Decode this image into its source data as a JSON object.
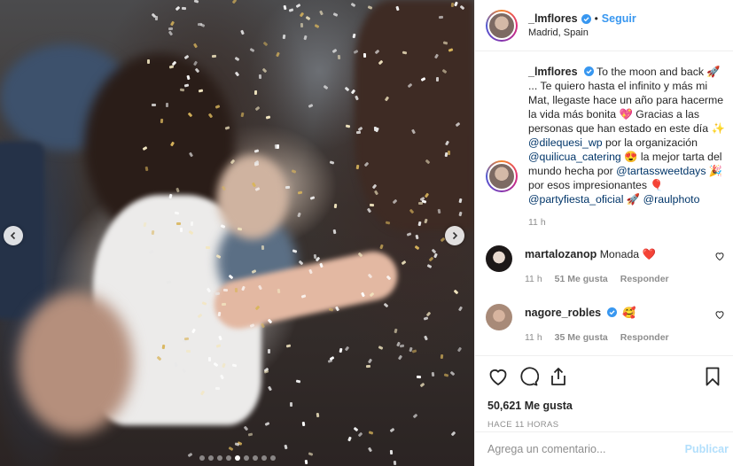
{
  "post": {
    "image_alt": "",
    "carousel": {
      "count": 9,
      "active_index": 4
    }
  },
  "header": {
    "username": "_lmflores",
    "separator": "•",
    "follow_label": "Seguir",
    "location": "Madrid, Spain"
  },
  "caption": {
    "username": "_lmflores",
    "parts": {
      "p1": "To the moon and back 🚀 ... Te quiero hasta el infinito y más mi Mat, llegaste hace un año para hacerme la vida más bonita 💖 Gracias a las personas que han estado en este día ✨ ",
      "m1": "@dilequesi_wp",
      "p2": " por la organización ",
      "m2": "@quilicua_catering",
      "p3": " 😍 la mejor tarta del mundo hecha por ",
      "m3": "@tartassweetdays",
      "p4": " 🎉 por esos impresionantes 🎈 ",
      "m4": "@partyfiesta_oficial",
      "p5": " 🚀 ",
      "m5": "@raulphoto"
    },
    "time": "11 h"
  },
  "comments": [
    {
      "username": "martalozanop",
      "text": "Monada ❤️",
      "time": "11 h",
      "likes": "51 Me gusta",
      "reply": "Responder",
      "verified": false
    },
    {
      "username": "nagore_robles",
      "text": "🥰",
      "time": "11 h",
      "likes": "35 Me gusta",
      "reply": "Responder",
      "verified": true
    }
  ],
  "actions": {
    "likes": "50,621 Me gusta",
    "posted": "HACE 11 HORAS"
  },
  "comment_box": {
    "placeholder": "Agrega un comentario...",
    "publish_label": "Publicar"
  },
  "colors": {
    "accent": "#3897f0",
    "link": "#003569",
    "muted": "#8e8e8e",
    "publish_disabled": "#b2dffc"
  },
  "icons": [
    "chevron-left-icon",
    "chevron-right-icon",
    "verified-icon",
    "heart-icon",
    "comment-icon",
    "share-icon",
    "bookmark-icon"
  ]
}
